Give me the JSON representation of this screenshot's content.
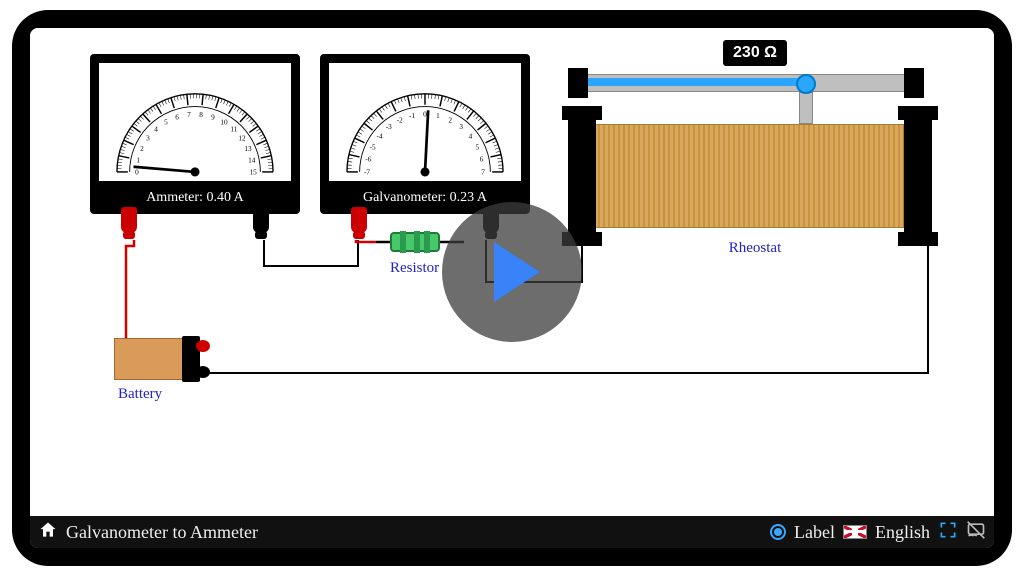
{
  "title": "Galvanometer to Ammeter",
  "rheostat": {
    "value": "230 Ω",
    "label": "Rheostat",
    "fraction": 0.68
  },
  "ammeter": {
    "caption": "Ammeter: 0.40 A",
    "min": 0,
    "max": 15,
    "value": 0.4
  },
  "galvanometer": {
    "caption": "Galvanometer: 0.23 A",
    "min": -7,
    "max": 7,
    "value": 0.23
  },
  "resistor_label": "Resistor",
  "battery_label": "Battery",
  "toolbar": {
    "label_toggle": "Label",
    "language": "English"
  }
}
